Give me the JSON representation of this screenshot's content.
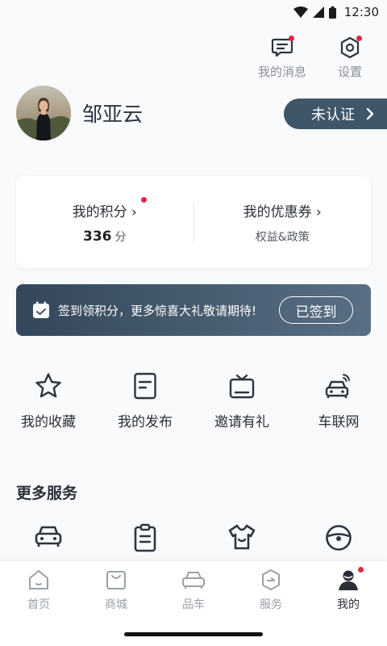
{
  "status_bar": {
    "time": "12:30"
  },
  "top_actions": {
    "messages_label": "我的消息",
    "settings_label": "设置"
  },
  "profile": {
    "name": "邹亚云",
    "verify_label": "未认证"
  },
  "points_card": {
    "points_title": "我的积分",
    "points_value": "336",
    "points_unit": "分",
    "coupons_title": "我的优惠券",
    "coupons_sub": "权益&政策"
  },
  "checkin": {
    "text": "签到领积分，更多惊喜大礼敬请期待!",
    "button_label": "已签到"
  },
  "quick_links": [
    {
      "label": "我的收藏",
      "icon": "star-icon"
    },
    {
      "label": "我的发布",
      "icon": "document-icon"
    },
    {
      "label": "邀请有礼",
      "icon": "gift-box-icon"
    },
    {
      "label": "车联网",
      "icon": "connected-car-icon"
    }
  ],
  "more_services": {
    "title": "更多服务",
    "icons": [
      "car-icon",
      "clipboard-icon",
      "shirt-icon",
      "steering-wheel-icon"
    ]
  },
  "tab_bar": {
    "tabs": [
      {
        "label": "首页",
        "icon": "home-icon",
        "active": false
      },
      {
        "label": "商城",
        "icon": "shopping-bag-icon",
        "active": false
      },
      {
        "label": "品车",
        "icon": "car-icon",
        "active": false
      },
      {
        "label": "服务",
        "icon": "service-icon",
        "active": false
      },
      {
        "label": "我的",
        "icon": "user-icon",
        "active": true
      }
    ]
  },
  "colors": {
    "accent": "#3e5668",
    "badge": "#e8253b",
    "text_primary": "#2b3038",
    "text_muted": "#8b9098"
  }
}
